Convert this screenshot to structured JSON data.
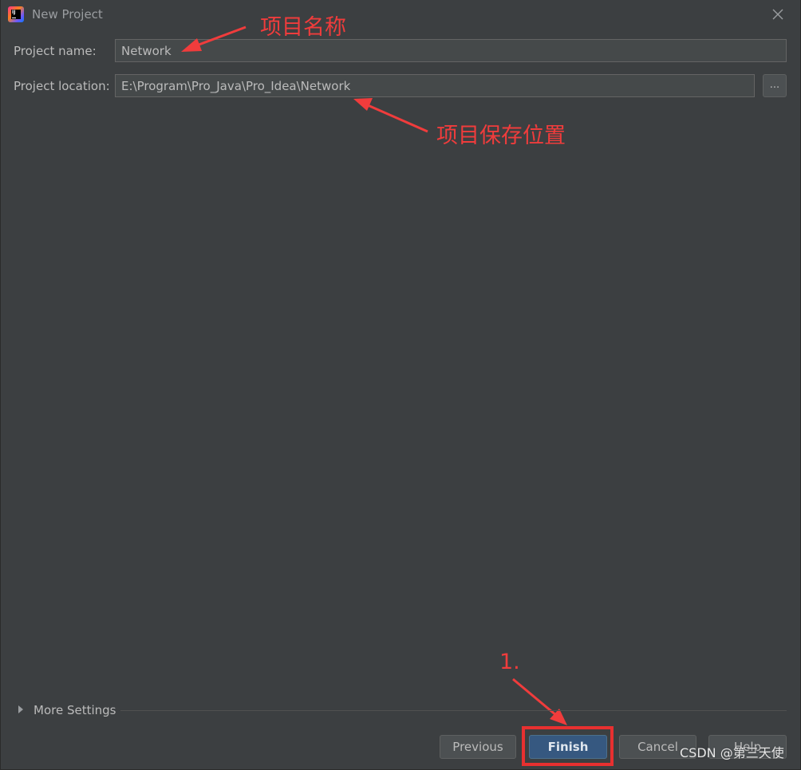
{
  "window": {
    "title": "New Project",
    "app_icon": "intellij-idea-icon",
    "app_icon_text": "IJ",
    "close_icon": "close-icon"
  },
  "form": {
    "project_name_label": "Project name:",
    "project_name_value": "Network",
    "project_location_label": "Project location:",
    "project_location_value": "E:\\Program\\Pro_Java\\Pro_Idea\\Network",
    "browse_label": "..."
  },
  "more_settings": {
    "label": "More Settings",
    "expand_icon": "triangle-right-icon"
  },
  "buttons": {
    "previous": "Previous",
    "finish": "Finish",
    "cancel": "Cancel",
    "help": "Help"
  },
  "annotations": {
    "project_name_note": "项目名称",
    "project_location_note": "项目保存位置",
    "step_label": "1.",
    "annotation_color": "#f03c3c"
  },
  "watermark": "CSDN @第三天使",
  "colors": {
    "background": "#3c3f41",
    "field_background": "#45494a",
    "text": "#bbbbbb",
    "primary_button": "#365880",
    "annotation_red": "#e83030"
  }
}
